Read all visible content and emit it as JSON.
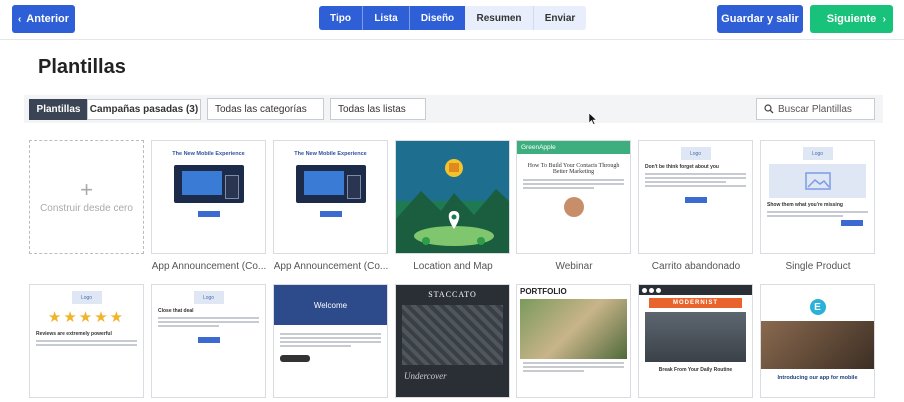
{
  "header": {
    "back_label": "Anterior",
    "save_label": "Guardar y salir",
    "next_label": "Siguiente",
    "steps": [
      {
        "label": "Tipo",
        "active": true
      },
      {
        "label": "Lista",
        "active": true
      },
      {
        "label": "Diseño",
        "active": true
      },
      {
        "label": "Resumen",
        "active": false
      },
      {
        "label": "Enviar",
        "active": false
      }
    ]
  },
  "page_title": "Plantillas",
  "filters": {
    "tabs": [
      {
        "label": "Plantillas",
        "active": true
      },
      {
        "label": "Campañas pasadas (3)",
        "active": false
      }
    ],
    "category_select": "Todas las categorías",
    "list_select": "Todas las listas",
    "search_placeholder": "Buscar Plantillas"
  },
  "templates_row1": [
    {
      "caption": "",
      "inner": "Construir desde cero"
    },
    {
      "caption": "App Announcement (Co...",
      "inner": "The New Mobile Experience"
    },
    {
      "caption": "App Announcement (Co...",
      "inner": "The New Mobile Experience"
    },
    {
      "caption": "Location and Map",
      "inner": ""
    },
    {
      "caption": "Webinar",
      "inner": "How To Build Your Contacts Through Better Marketing",
      "brand": "GreenApple"
    },
    {
      "caption": "Carrito abandonado",
      "inner": "Don't be think forget about you",
      "logo": "Logo"
    },
    {
      "caption": "Single Product",
      "inner": "Show them what you're missing",
      "logo": "Logo"
    }
  ],
  "templates_row2": [
    {
      "inner": "Reviews are extremely powerful",
      "logo": "Logo"
    },
    {
      "inner": "Close that deal",
      "logo": "Logo"
    },
    {
      "inner": "Welcome"
    },
    {
      "inner": "STACCATO",
      "sub": "Undercover"
    },
    {
      "inner": "PORTFOLIO"
    },
    {
      "inner": "MODERNIST",
      "sub": "Break From Your Daily Routine"
    },
    {
      "inner": "Introducing our app for mobile"
    }
  ],
  "colors": {
    "primary": "#2e5fd6",
    "success": "#19c27a",
    "dark_tab": "#3b4454",
    "map_green": "#1f7a52",
    "greenapple": "#3fae7f"
  }
}
